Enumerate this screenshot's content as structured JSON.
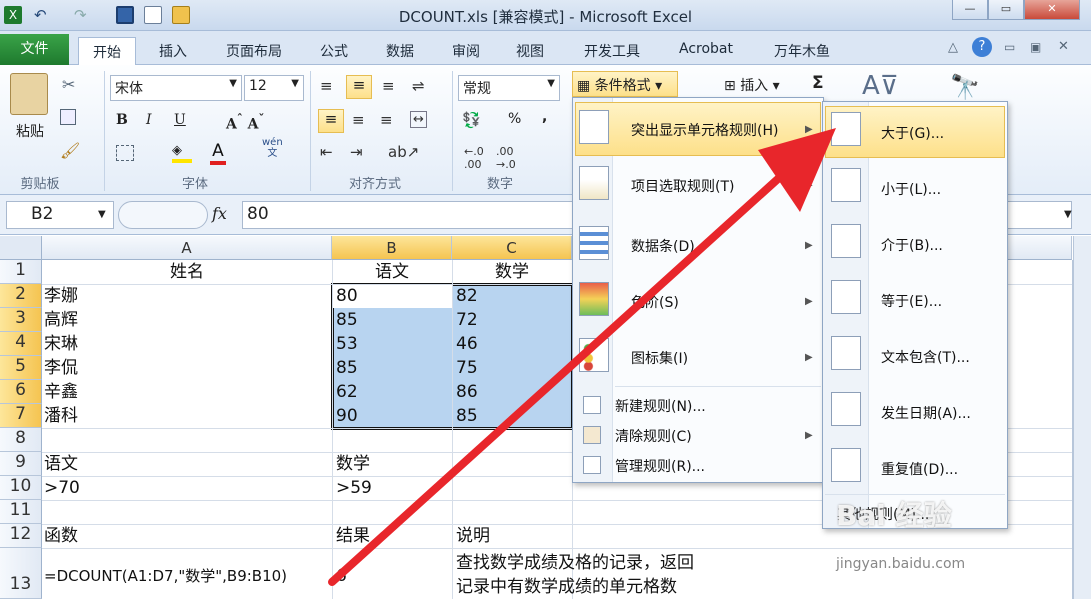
{
  "window": {
    "title": "DCOUNT.xls  [兼容模式]  -  Microsoft Excel"
  },
  "tabs": [
    "文件",
    "开始",
    "插入",
    "页面布局",
    "公式",
    "数据",
    "审阅",
    "视图",
    "开发工具",
    "Acrobat",
    "万年木鱼"
  ],
  "ribbon": {
    "font_name": "宋体",
    "font_size": "12",
    "number_format": "常规",
    "paste": "粘贴",
    "groups": {
      "clipboard": "剪贴板",
      "font": "字体",
      "align": "对齐方式",
      "number": "数字"
    },
    "cond_format": "条件格式",
    "insert": "插入",
    "sigma": "Σ",
    "format_btns": {
      "bold": "B",
      "italic": "I",
      "underline": "U",
      "wen": "wén\n文",
      "percent": "%",
      "comma": ","
    }
  },
  "formula_bar": {
    "name_box": "B2",
    "fx": "fx",
    "value": "80"
  },
  "columns": [
    "A",
    "B",
    "C"
  ],
  "rows": [
    "1",
    "2",
    "3",
    "4",
    "5",
    "6",
    "7",
    "8",
    "9",
    "10",
    "11",
    "12",
    "13"
  ],
  "cells": {
    "A1": "姓名",
    "B1": "语文",
    "C1": "数学",
    "A2": "李娜",
    "B2": "80",
    "C2": "82",
    "A3": "高辉",
    "B3": "85",
    "C3": "72",
    "A4": "宋琳",
    "B4": "53",
    "C4": "46",
    "A5": "李侃",
    "B5": "85",
    "C5": "75",
    "A6": "辛鑫",
    "B6": "62",
    "C6": "86",
    "A7": "潘科",
    "B7": "90",
    "C7": "85",
    "A9": "语文",
    "B9": "数学",
    "A10": ">70",
    "B10": ">59",
    "A12": "函数",
    "B12": "结果",
    "C12": "说明",
    "A13": "=DCOUNT(A1:D7,\"数学\",B9:B10)",
    "B13": "6",
    "C13a": "查找数学成绩及格的记录，返回",
    "C13b": "记录中有数学成绩的单元格数"
  },
  "cond_menu": {
    "items": [
      "突出显示单元格规则(H)",
      "项目选取规则(T)",
      "数据条(D)",
      "色阶(S)",
      "图标集(I)"
    ],
    "small_items": [
      "新建规则(N)...",
      "清除规则(C)",
      "管理规则(R)..."
    ]
  },
  "highlight_menu": {
    "items": [
      "大于(G)...",
      "小于(L)...",
      "介于(B)...",
      "等于(E)...",
      "文本包含(T)...",
      "发生日期(A)...",
      "重复值(D)..."
    ],
    "more": "其他规则(M)..."
  },
  "watermark": {
    "brand": "Bai 经验",
    "url": "jingyan.baidu.com"
  },
  "colors": {
    "accent": "#f5c451",
    "selection": "#b8d4f0",
    "arrow": "#e8262b",
    "file_tab": "#2a8c3a"
  }
}
